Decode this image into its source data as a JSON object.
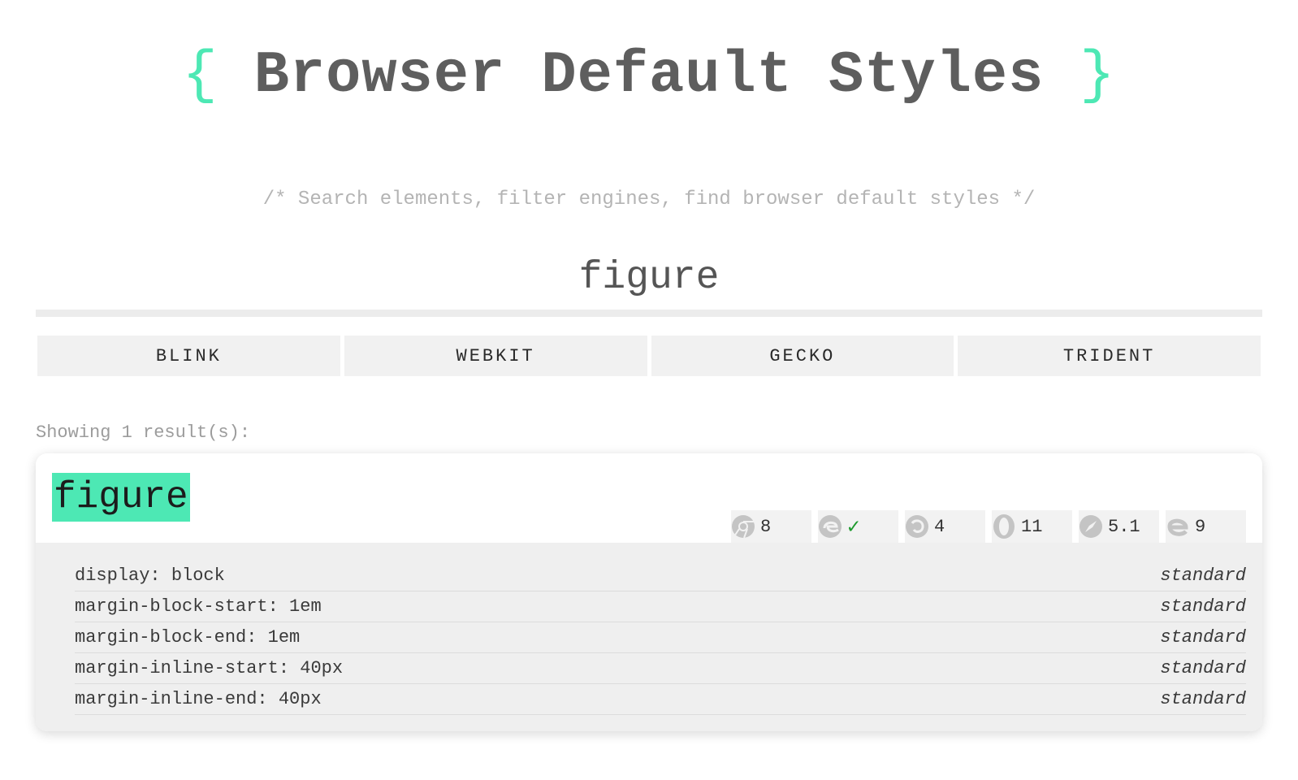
{
  "header": {
    "brace_open": "{",
    "title": "Browser Default Styles",
    "brace_close": "}",
    "tagline": "/* Search elements, filter engines, find browser default styles */"
  },
  "search": {
    "value": "figure",
    "placeholder": ""
  },
  "engines": [
    {
      "label": "BLINK"
    },
    {
      "label": "WEBKIT"
    },
    {
      "label": "GECKO"
    },
    {
      "label": "TRIDENT"
    }
  ],
  "results": {
    "count_text": "Showing 1 result(s):"
  },
  "card": {
    "element": "figure",
    "support": [
      {
        "browser": "chrome-icon",
        "version": "8"
      },
      {
        "browser": "edge-icon",
        "version": "✓"
      },
      {
        "browser": "firefox-icon",
        "version": "4"
      },
      {
        "browser": "opera-icon",
        "version": "11"
      },
      {
        "browser": "safari-icon",
        "version": "5.1"
      },
      {
        "browser": "ie-icon",
        "version": "9"
      }
    ],
    "properties": [
      {
        "declaration": "display: block",
        "status": "standard"
      },
      {
        "declaration": "margin-block-start: 1em",
        "status": "standard"
      },
      {
        "declaration": "margin-block-end: 1em",
        "status": "standard"
      },
      {
        "declaration": "margin-inline-start: 40px",
        "status": "standard"
      },
      {
        "declaration": "margin-inline-end: 40px",
        "status": "standard"
      }
    ]
  },
  "colors": {
    "accent": "#4de8b4",
    "check": "#1d9a2d"
  }
}
